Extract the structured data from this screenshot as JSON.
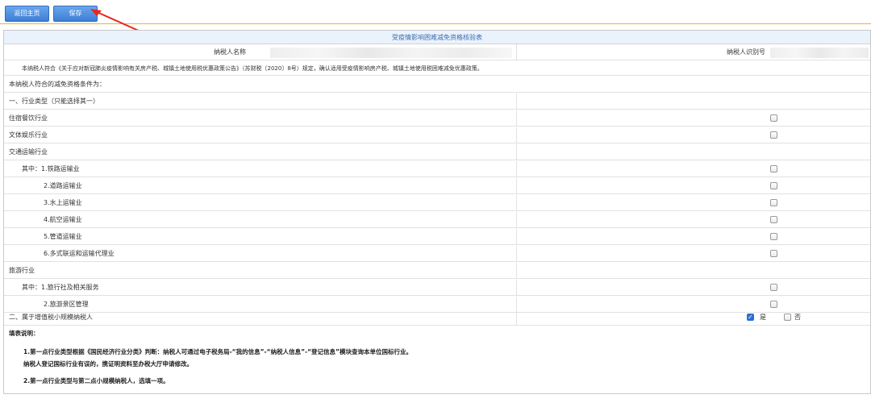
{
  "toolbar": {
    "home_label": "返回主页",
    "save_label": "保存",
    "accent_color": "#3d7ed6"
  },
  "form": {
    "title": "受疫情影响困难减免资格核验表",
    "taxpayer_name_label": "纳税人名称",
    "taxpayer_id_label": "纳税人识别号",
    "statement": "本纳税人符合《关于应对新冠肺炎疫情影响有关房产税、城镇土地使用税优惠政策公告》（苏财税〔2020〕8号）规定，确认适用受疫情影响房产税、城镇土地使用税困难减免优惠政策。",
    "conditions_label": "本纳税人符合的减免资格条件为：",
    "section1_label": "一、行业类型（只能选择其一）",
    "industries": [
      {
        "label": "住宿餐饮行业",
        "checked": false
      },
      {
        "label": "文体娱乐行业",
        "checked": false
      },
      {
        "label": "交通运输行业",
        "checked": null
      },
      {
        "label": "其中：1.铁路运输业",
        "checked": false
      },
      {
        "label": "2.道路运输业",
        "checked": false
      },
      {
        "label": "3.水上运输业",
        "checked": false
      },
      {
        "label": "4.航空运输业",
        "checked": false
      },
      {
        "label": "5.管道运输业",
        "checked": false
      },
      {
        "label": "6.多式联运和运输代理业",
        "checked": false
      },
      {
        "label": "旅游行业",
        "checked": null
      },
      {
        "label": "其中：1.旅行社及相关服务",
        "checked": false
      },
      {
        "label": "2.旅游景区管理",
        "checked": false
      }
    ],
    "section2_label": "二、属于增值税小规模纳税人",
    "yes_label": "是",
    "no_label": "否",
    "small_scale_yes_checked": true
  },
  "notes": {
    "heading": "填表说明：",
    "line1": "1.第一点行业类型根据《国民经济行业分类》判断：纳税人可通过电子税务局-“我的信息”-“纳税人信息”-“登记信息”模块查询本单位国标行业。",
    "line2": "纳税人登记国标行业有误的，携证明资料至办税大厅申请修改。",
    "line3": "2.第一点行业类型与第二点小规模纳税人，选填一项。"
  }
}
